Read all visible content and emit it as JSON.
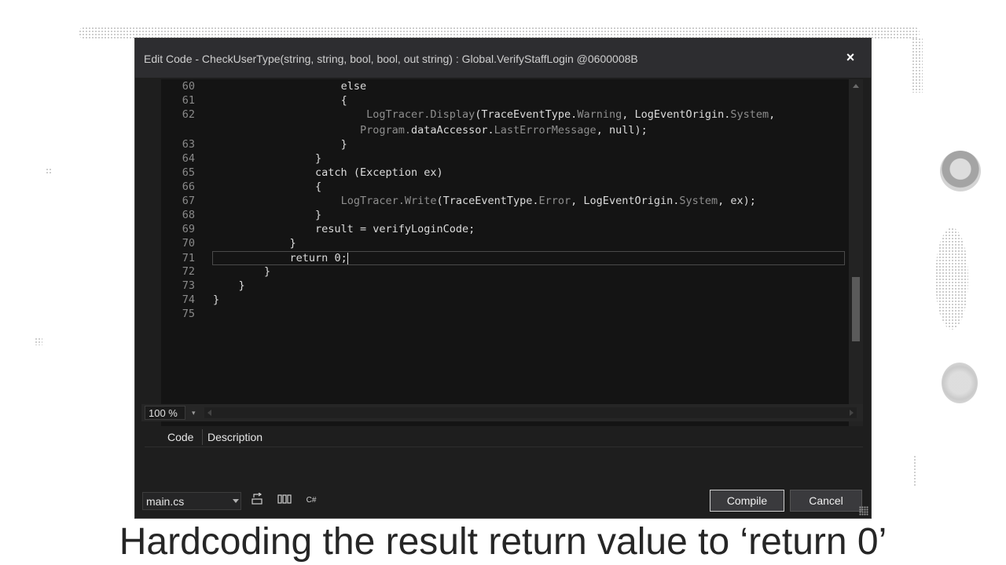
{
  "dialog": {
    "title": "Edit Code - CheckUserType(string, string, bool, bool, out string) : Global.VerifyStaffLogin @0600008B",
    "close_label": "×"
  },
  "editor": {
    "lines": [
      {
        "num": "60",
        "indent": "                    ",
        "parts": [
          {
            "t": "else",
            "c": ""
          }
        ]
      },
      {
        "num": "61",
        "indent": "                    ",
        "parts": [
          {
            "t": "{",
            "c": ""
          }
        ]
      },
      {
        "num": "62",
        "indent": "                        ",
        "parts": [
          {
            "t": "LogTracer.",
            "c": "gray"
          },
          {
            "t": "Display",
            "c": "gray"
          },
          {
            "t": "(TraceEventType.",
            "c": ""
          },
          {
            "t": "Warning",
            "c": "gray"
          },
          {
            "t": ", LogEventOrigin.",
            "c": ""
          },
          {
            "t": "System",
            "c": "gray"
          },
          {
            "t": ",",
            "c": ""
          }
        ]
      },
      {
        "num": "",
        "indent": "                       ",
        "parts": [
          {
            "t": "Program.",
            "c": "gray"
          },
          {
            "t": "dataAccessor.",
            "c": ""
          },
          {
            "t": "LastErrorMessage",
            "c": "gray"
          },
          {
            "t": ", null);",
            "c": ""
          }
        ]
      },
      {
        "num": "63",
        "indent": "                    ",
        "parts": [
          {
            "t": "}",
            "c": ""
          }
        ]
      },
      {
        "num": "64",
        "indent": "                ",
        "parts": [
          {
            "t": "}",
            "c": ""
          }
        ]
      },
      {
        "num": "65",
        "indent": "                ",
        "parts": [
          {
            "t": "catch (Exception ex)",
            "c": ""
          }
        ]
      },
      {
        "num": "66",
        "indent": "                ",
        "parts": [
          {
            "t": "{",
            "c": ""
          }
        ]
      },
      {
        "num": "67",
        "indent": "                    ",
        "parts": [
          {
            "t": "LogTracer.",
            "c": "gray"
          },
          {
            "t": "Write",
            "c": "gray"
          },
          {
            "t": "(TraceEventType.",
            "c": ""
          },
          {
            "t": "Error",
            "c": "gray"
          },
          {
            "t": ", LogEventOrigin.",
            "c": ""
          },
          {
            "t": "System",
            "c": "gray"
          },
          {
            "t": ", ex);",
            "c": ""
          }
        ]
      },
      {
        "num": "68",
        "indent": "                ",
        "parts": [
          {
            "t": "}",
            "c": ""
          }
        ]
      },
      {
        "num": "69",
        "indent": "                ",
        "parts": [
          {
            "t": "result = verifyLoginCode;",
            "c": ""
          }
        ]
      },
      {
        "num": "70",
        "indent": "            ",
        "parts": [
          {
            "t": "}",
            "c": ""
          }
        ]
      },
      {
        "num": "71",
        "indent": "            ",
        "parts": [
          {
            "t": "return 0;",
            "c": ""
          }
        ],
        "current": true
      },
      {
        "num": "72",
        "indent": "        ",
        "parts": [
          {
            "t": "}",
            "c": ""
          }
        ]
      },
      {
        "num": "73",
        "indent": "    ",
        "parts": [
          {
            "t": "}",
            "c": ""
          }
        ]
      },
      {
        "num": "74",
        "indent": "",
        "parts": [
          {
            "t": "}",
            "c": ""
          }
        ]
      },
      {
        "num": "75",
        "indent": "",
        "parts": []
      }
    ],
    "zoom": "100 %"
  },
  "errors_panel": {
    "col_code": "Code",
    "col_description": "Description"
  },
  "footer": {
    "file": "main.cs",
    "compile_label": "Compile",
    "cancel_label": "Cancel",
    "language_icon_text": "C#"
  },
  "caption": "Hardcoding the result return value to ‘return 0’"
}
